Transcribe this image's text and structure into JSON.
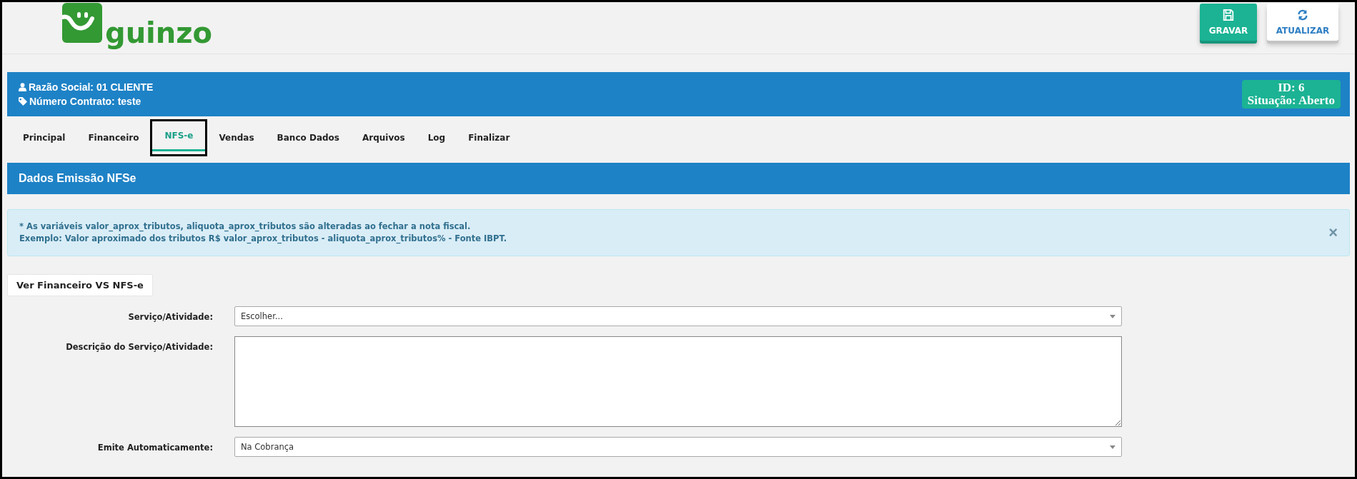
{
  "logo": {
    "text": "guinzo"
  },
  "toolbar": {
    "buttons": [
      {
        "label": "GRAVAR",
        "kind": "save"
      },
      {
        "label": "ATUALIZAR",
        "kind": "refresh"
      }
    ]
  },
  "record_header": {
    "razao_social": "Razão Social: 01 CLIENTE",
    "numero_contrato": "Número Contrato: teste",
    "id": "ID: 6",
    "situacao": "Situação: Aberto"
  },
  "tabs": [
    {
      "label": "Principal",
      "selected": false
    },
    {
      "label": "Financeiro",
      "selected": false
    },
    {
      "label": "NFS-e",
      "selected": true
    },
    {
      "label": "Vendas",
      "selected": false
    },
    {
      "label": "Banco Dados",
      "selected": false
    },
    {
      "label": "Arquivos",
      "selected": false
    },
    {
      "label": "Log",
      "selected": false
    },
    {
      "label": "Finalizar",
      "selected": false
    }
  ],
  "section": {
    "title": "Dados Emissão NFSe"
  },
  "alert": {
    "lines": [
      "* As variáveis valor_aprox_tributos, aliquota_aprox_tributos são alteradas ao fechar a nota fiscal.",
      "Exemplo: Valor aproximado dos tributos R$ valor_aprox_tributos - aliquota_aprox_tributos% - Fonte IBPT."
    ],
    "close": "×"
  },
  "view_button": {
    "label": "Ver Financeiro VS NFS-e"
  },
  "form": [
    {
      "label": "Serviço/Atividade:",
      "kind": "select",
      "value": "Escolher..."
    },
    {
      "label": "Descrição do Serviço/Atividade:",
      "kind": "textarea"
    },
    {
      "label": "Emite Automaticamente:",
      "kind": "select",
      "value": "Na Cobrança"
    }
  ]
}
